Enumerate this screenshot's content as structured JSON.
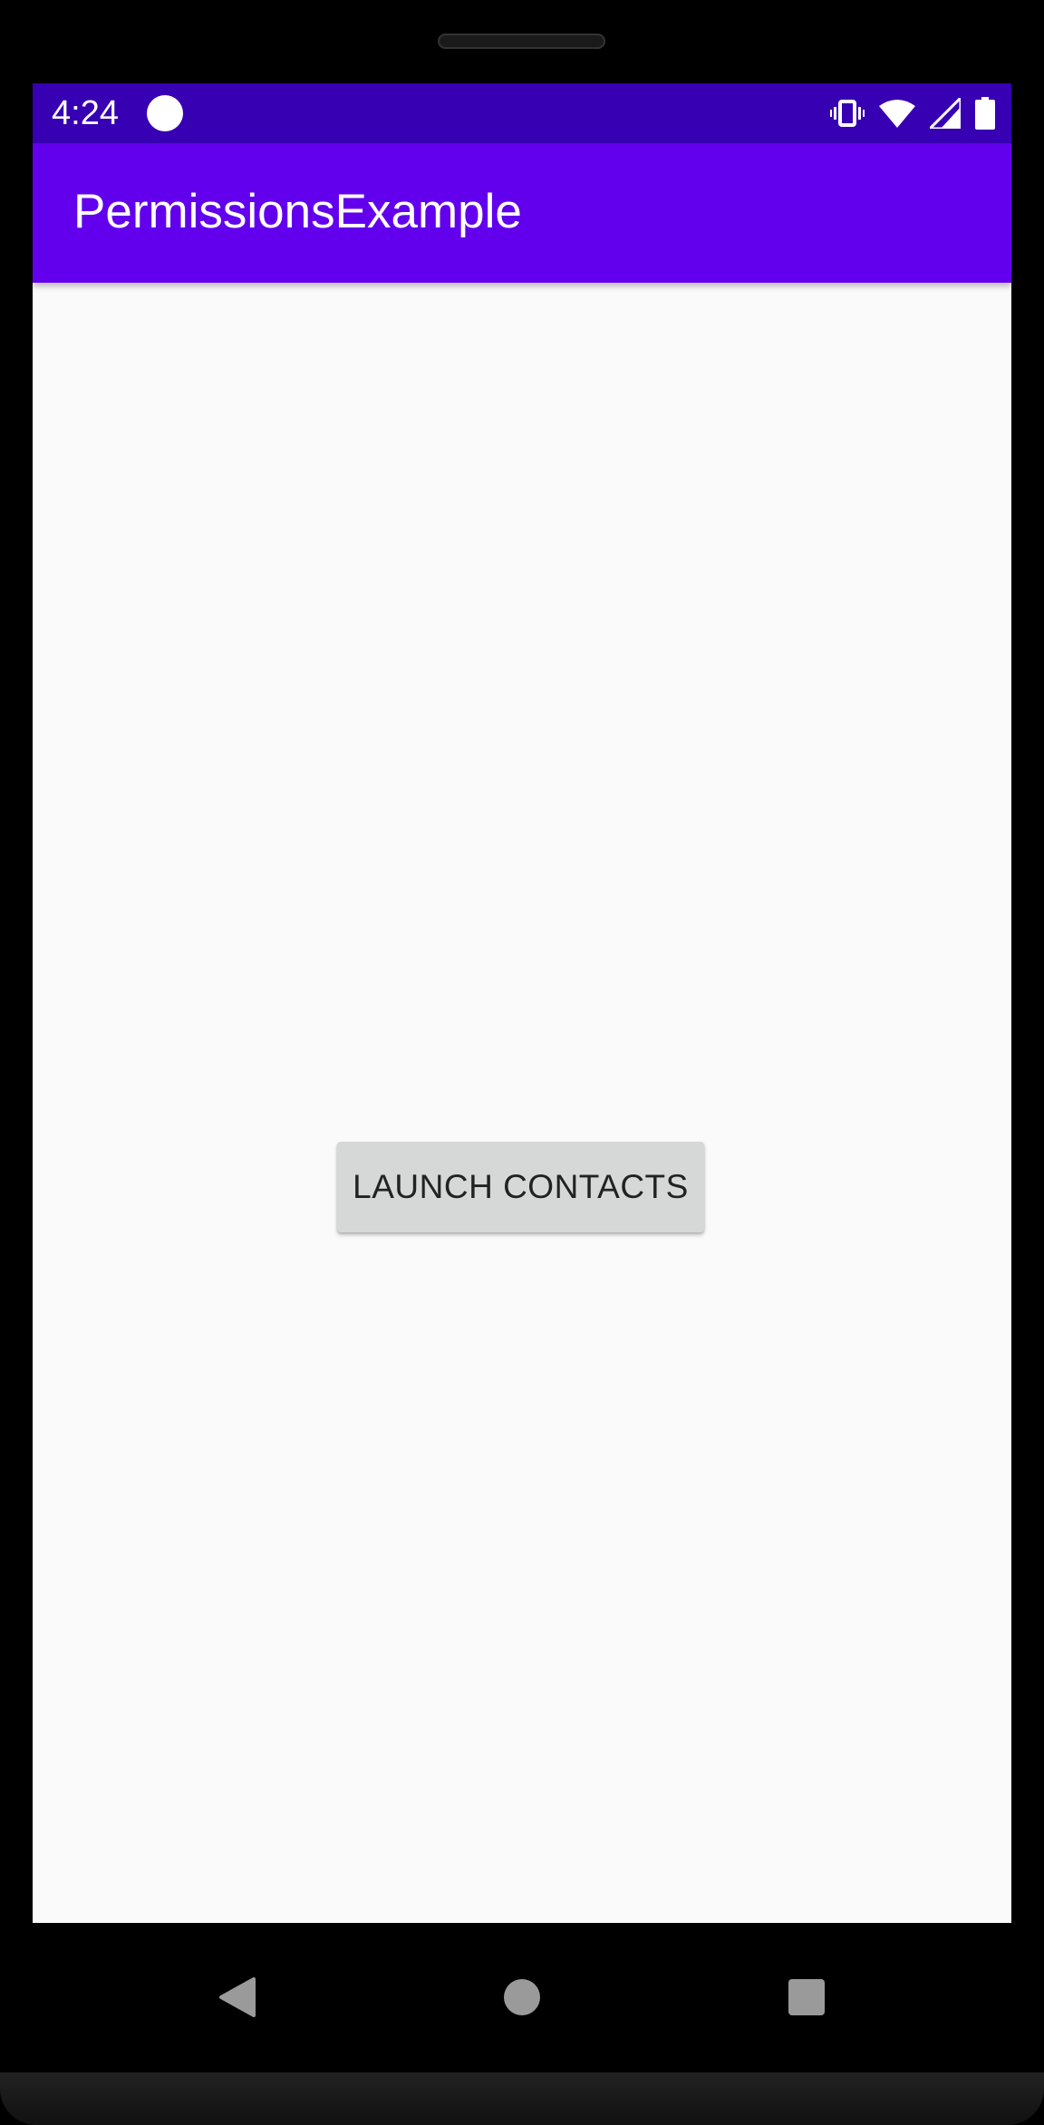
{
  "status_bar": {
    "time": "4:24",
    "background": "#3700b3",
    "icons": [
      "notification-dot-icon",
      "vibrate-icon",
      "wifi-icon",
      "cell-signal-icon",
      "battery-icon"
    ]
  },
  "app_bar": {
    "title": "PermissionsExample",
    "background": "#6200ee"
  },
  "main": {
    "launch_button_label": "LAUNCH CONTACTS",
    "background": "#fafafa"
  },
  "nav_bar": {
    "buttons": [
      "back-icon",
      "home-icon",
      "recents-icon"
    ]
  }
}
